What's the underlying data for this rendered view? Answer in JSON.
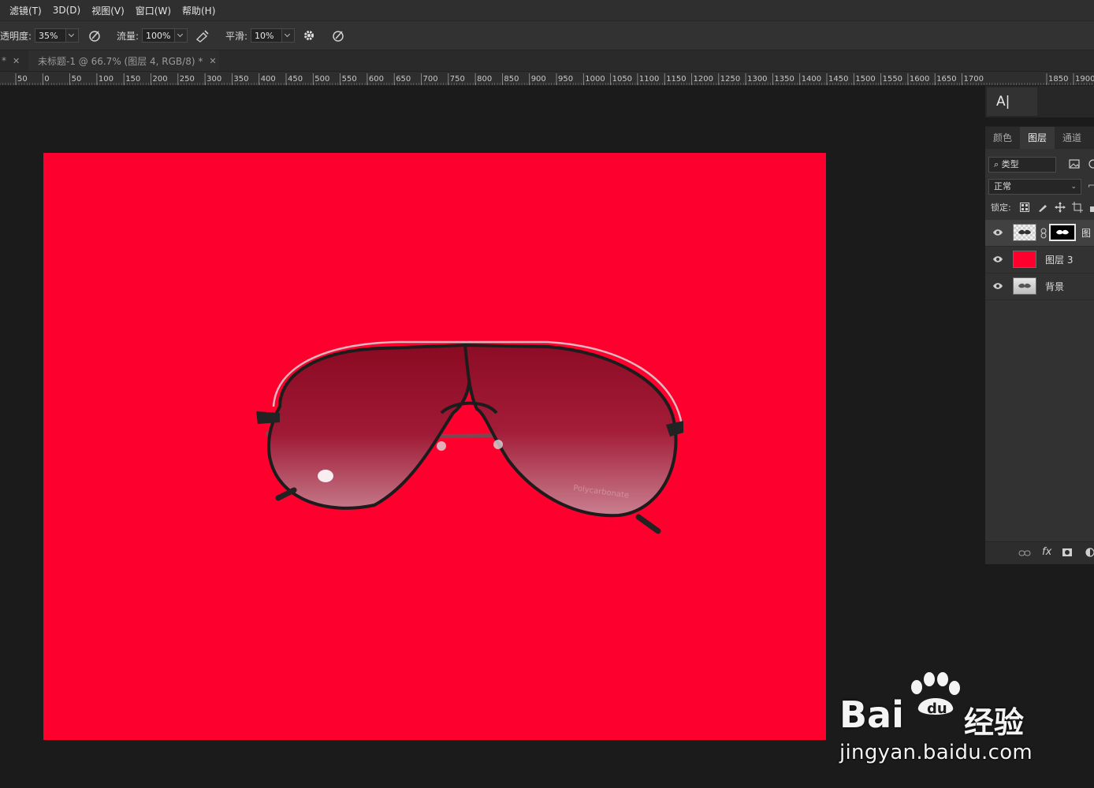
{
  "menu": [
    "滤镜(T)",
    "3D(D)",
    "视图(V)",
    "窗口(W)",
    "帮助(H)"
  ],
  "options": {
    "opacity_label": "透明度:",
    "opacity_value": "35%",
    "flow_label": "流量:",
    "flow_value": "100%",
    "smooth_label": "平滑:",
    "smooth_value": "10%"
  },
  "tabs": {
    "first_tab_suffix": "*",
    "active_title": "未标题-1 @ 66.7% (图层 4, RGB/8) *"
  },
  "ruler_labels": [
    "50",
    "0",
    "50",
    "100",
    "150",
    "200",
    "250",
    "300",
    "350",
    "400",
    "450",
    "500",
    "550",
    "600",
    "650",
    "700",
    "750",
    "800",
    "850",
    "900",
    "950",
    "1000",
    "1050",
    "1100",
    "1150",
    "1200",
    "1250",
    "1300",
    "1350",
    "1400",
    "1450",
    "1500",
    "1550",
    "1600",
    "1650",
    "1700",
    "1850",
    "1900"
  ],
  "char_panel": {
    "label": "A|"
  },
  "layers_panel": {
    "tabs": [
      "颜色",
      "图层",
      "通道"
    ],
    "active_tab": "图层",
    "filter_label": "类型",
    "blend_mode": "正常",
    "lock_label": "锁定:",
    "layers": [
      {
        "name": "图",
        "selected": true
      },
      {
        "name": "图层 3",
        "selected": false
      },
      {
        "name": "背景",
        "selected": false
      }
    ],
    "footer_fx": "fx"
  },
  "watermark": {
    "brand": "Bai",
    "brand_cn": "经验",
    "url": "jingyan.baidu.com"
  },
  "colors": {
    "canvas": "#fe002e",
    "workspace": "#1b1b1b",
    "panel": "#323232"
  }
}
